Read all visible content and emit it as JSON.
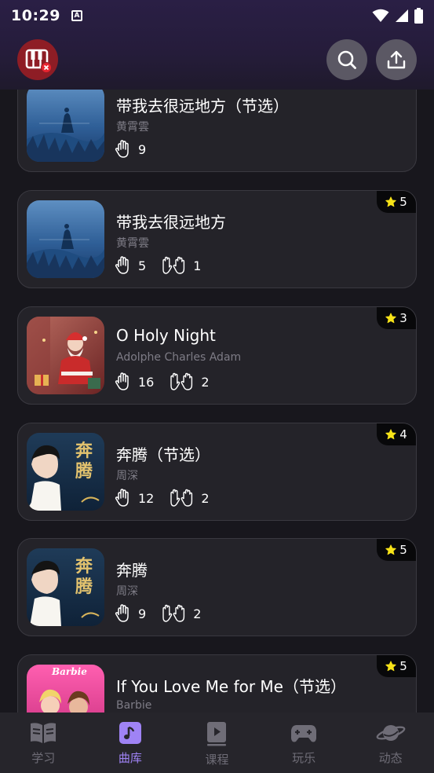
{
  "status_bar": {
    "time": "10:29",
    "a_icon": "A"
  },
  "header": {
    "logo_icon": "piano-keys-icon",
    "search_icon": "search-icon",
    "upload_icon": "upload-icon"
  },
  "songs": [
    {
      "title": "带我去很远地方（节选）",
      "artist": "黄霄雲",
      "solo_count": "9",
      "duet_count": "",
      "rating": "",
      "cover": "blue-night-art"
    },
    {
      "title": "带我去很远地方",
      "artist": "黄霄雲",
      "solo_count": "5",
      "duet_count": "1",
      "rating": "5",
      "cover": "blue-night-art"
    },
    {
      "title": "O Holy Night",
      "artist": "Adolphe Charles Adam",
      "solo_count": "16",
      "duet_count": "2",
      "rating": "3",
      "cover": "santa-art"
    },
    {
      "title": "奔腾（节选）",
      "artist": "周深",
      "solo_count": "12",
      "duet_count": "2",
      "rating": "4",
      "cover": "portrait-art",
      "cover_text": "奔腾"
    },
    {
      "title": "奔腾",
      "artist": "周深",
      "solo_count": "9",
      "duet_count": "2",
      "rating": "5",
      "cover": "portrait-art",
      "cover_text": "奔腾"
    },
    {
      "title": "If You Love Me for Me（节选）",
      "artist": "Barbie",
      "solo_count": "",
      "duet_count": "",
      "rating": "5",
      "cover": "barbie-art",
      "cover_text": "Barbie"
    }
  ],
  "bottom_nav": [
    {
      "label": "学习",
      "icon": "book-icon",
      "active": false
    },
    {
      "label": "曲库",
      "icon": "music-note-icon",
      "active": true
    },
    {
      "label": "课程",
      "icon": "video-play-icon",
      "active": false
    },
    {
      "label": "玩乐",
      "icon": "gamepad-icon",
      "active": false
    },
    {
      "label": "动态",
      "icon": "planet-icon",
      "active": false
    }
  ],
  "colors": {
    "accent": "#9f83f5",
    "star": "#f7e318",
    "background": "#18171d",
    "card": "#242329"
  }
}
